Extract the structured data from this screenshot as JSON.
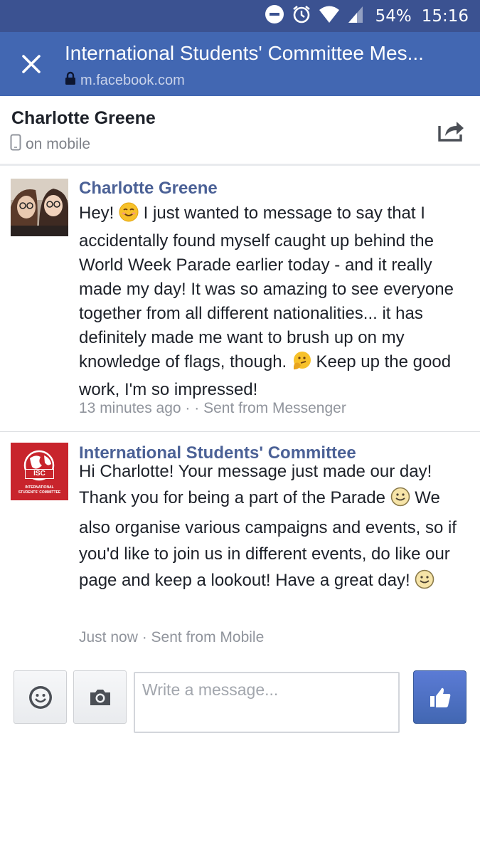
{
  "status_bar": {
    "battery_percent": "54%",
    "time": "15:16",
    "icons": [
      "do-not-disturb-icon",
      "alarm-icon",
      "wifi-icon",
      "cell-signal-icon"
    ]
  },
  "browser": {
    "title": "International Students' Committee Mes...",
    "url": "m.facebook.com",
    "colors": {
      "bar": "#4267b2",
      "status": "#3b5291"
    }
  },
  "conversation": {
    "name": "Charlotte Greene",
    "status": "on mobile"
  },
  "messages": [
    {
      "sender": "Charlotte Greene",
      "parts": [
        "Hey! ",
        " I just wanted to message to say that I accidentally found myself caught up behind the World Week Parade earlier today - and it really made my day! It was so amazing to see everyone together from all different nationalities... it has definitely made me want to brush up on my knowledge of flags, though. ",
        " Keep up the good work, I'm so impressed!"
      ],
      "emojis": [
        "smiling-face-icon",
        "thinking-face-icon"
      ],
      "meta": "13 minutes ago · · Sent from Messenger"
    },
    {
      "sender": "International Students' Committee",
      "parts": [
        "Hi Charlotte! Your message just made our day! Thank you for being a part of the Parade ",
        " We also organise various campaigns and events, so if you'd like to join us in different events, do like our page and keep a lookout! Have a great day! ",
        ""
      ],
      "emojis": [
        "slight-smile-icon",
        "slight-smile-icon"
      ],
      "logo_text": [
        "ISC",
        "INTERNATIONAL",
        "STUDENTS' COMMITTEE"
      ],
      "meta": "Just now · Sent from Mobile"
    }
  ],
  "composer": {
    "placeholder": "Write a message..."
  }
}
